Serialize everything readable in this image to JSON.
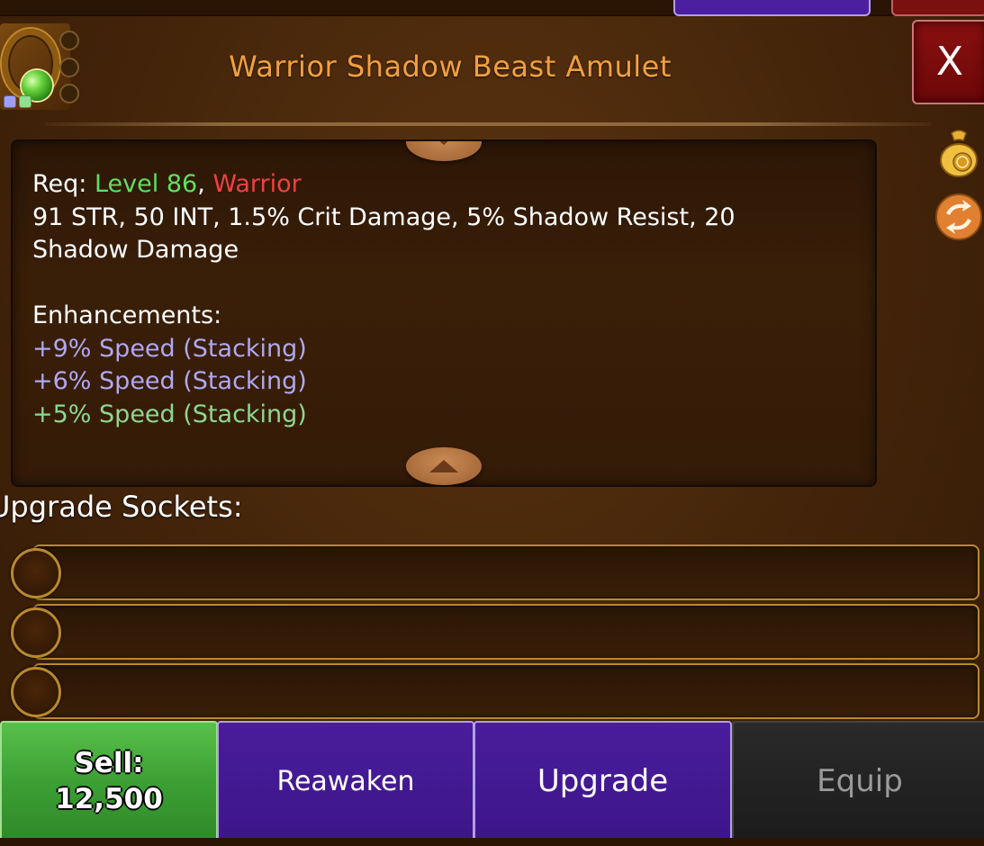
{
  "item": {
    "title": "Warrior Shadow Beast Amulet",
    "icon": "amulet-icon"
  },
  "close_label": "X",
  "description": {
    "req_prefix": "Req: ",
    "req_level": "Level 86",
    "req_sep": ", ",
    "req_class": "Warrior",
    "stats_line1": "91 STR, 50 INT, 1.5% Crit Damage, 5% Shadow Resist, 20",
    "stats_line2": "Shadow Damage",
    "enhancements_header": "Enhancements:",
    "enhancements": [
      "+9% Speed (Stacking)",
      "+6% Speed (Stacking)",
      "+5% Speed (Stacking)"
    ]
  },
  "side_icons": [
    "money-bag-icon",
    "swap-arrows-icon"
  ],
  "sockets": {
    "label": "Upgrade Sockets:",
    "slots": [
      "",
      "",
      ""
    ]
  },
  "actions": {
    "sell_label": "Sell:",
    "sell_price": "12,500",
    "reawaken_label": "Reawaken",
    "upgrade_label": "Upgrade",
    "equip_label": "Equip"
  },
  "colors": {
    "title": "#f0a040",
    "level_requirement": "#5fe05f",
    "class_requirement": "#f04040",
    "enhancement_purple": "#b0a8f0",
    "enhancement_green": "#8ed88e",
    "sell_button": "#3ca034",
    "purple_button": "#3d168a",
    "disabled_button": "#1c1c1c"
  }
}
